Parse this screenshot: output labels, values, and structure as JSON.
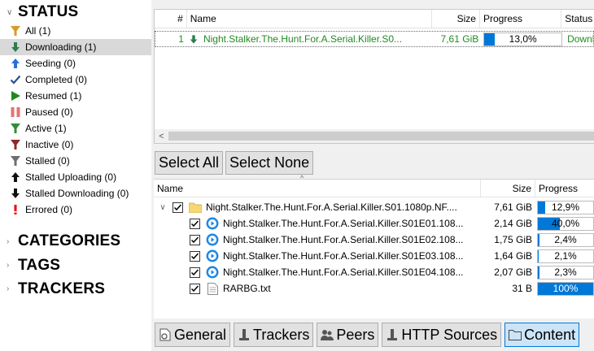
{
  "sidebar": {
    "status_title": "STATUS",
    "status_items": [
      {
        "label": "All (1)",
        "icon": "filter-icon"
      },
      {
        "label": "Downloading (1)",
        "icon": "download-arrow-icon"
      },
      {
        "label": "Seeding (0)",
        "icon": "upload-arrow-icon"
      },
      {
        "label": "Completed (0)",
        "icon": "checkmark-icon"
      },
      {
        "label": "Resumed (1)",
        "icon": "play-icon"
      },
      {
        "label": "Paused (0)",
        "icon": "pause-icon"
      },
      {
        "label": "Active (1)",
        "icon": "active-filter-icon"
      },
      {
        "label": "Inactive (0)",
        "icon": "inactive-filter-icon"
      },
      {
        "label": "Stalled (0)",
        "icon": "stalled-filter-icon"
      },
      {
        "label": "Stalled Uploading (0)",
        "icon": "stalled-upload-icon"
      },
      {
        "label": "Stalled Downloading (0)",
        "icon": "stalled-download-icon"
      },
      {
        "label": "Errored (0)",
        "icon": "error-icon"
      }
    ],
    "categories_title": "CATEGORIES",
    "tags_title": "TAGS",
    "trackers_title": "TRACKERS"
  },
  "torrent_list": {
    "columns": {
      "num": "#",
      "name": "Name",
      "size": "Size",
      "progress": "Progress",
      "status": "Status"
    },
    "rows": [
      {
        "num": "1",
        "name": "Night.Stalker.The.Hunt.For.A.Serial.Killer.S0...",
        "size": "7,61 GiB",
        "progress_text": "13,0%",
        "progress": 0.13,
        "status": "Downlo"
      }
    ]
  },
  "buttons": {
    "select_all": "Select All",
    "select_none": "Select None"
  },
  "content_tree": {
    "columns": {
      "name": "Name",
      "size": "Size",
      "progress": "Progress"
    },
    "folder": {
      "name": "Night.Stalker.The.Hunt.For.A.Serial.Killer.S01.1080p.NF....",
      "size": "7,61 GiB",
      "progress_text": "12,9%",
      "progress": 0.129
    },
    "files": [
      {
        "name": "Night.Stalker.The.Hunt.For.A.Serial.Killer.S01E01.108...",
        "size": "2,14 GiB",
        "progress_text": "40,0%",
        "progress": 0.4,
        "icon": "video-file-icon"
      },
      {
        "name": "Night.Stalker.The.Hunt.For.A.Serial.Killer.S01E02.108...",
        "size": "1,75 GiB",
        "progress_text": "2,4%",
        "progress": 0.024,
        "icon": "video-file-icon"
      },
      {
        "name": "Night.Stalker.The.Hunt.For.A.Serial.Killer.S01E03.108...",
        "size": "1,64 GiB",
        "progress_text": "2,1%",
        "progress": 0.021,
        "icon": "video-file-icon"
      },
      {
        "name": "Night.Stalker.The.Hunt.For.A.Serial.Killer.S01E04.108...",
        "size": "2,07 GiB",
        "progress_text": "2,3%",
        "progress": 0.023,
        "icon": "video-file-icon"
      },
      {
        "name": "RARBG.txt",
        "size": "31 B",
        "progress_text": "100%",
        "progress": 1.0,
        "icon": "text-file-icon"
      }
    ]
  },
  "tabs": [
    {
      "label": "General",
      "icon": "general-icon"
    },
    {
      "label": "Trackers",
      "icon": "trackers-icon"
    },
    {
      "label": "Peers",
      "icon": "peers-icon"
    },
    {
      "label": "HTTP Sources",
      "icon": "http-sources-icon"
    },
    {
      "label": "Content",
      "icon": "folder-icon",
      "active": true
    }
  ],
  "colors": {
    "accent": "#0078d7",
    "downloading_text": "#218a21",
    "selected_bg": "#d9d9d9"
  }
}
